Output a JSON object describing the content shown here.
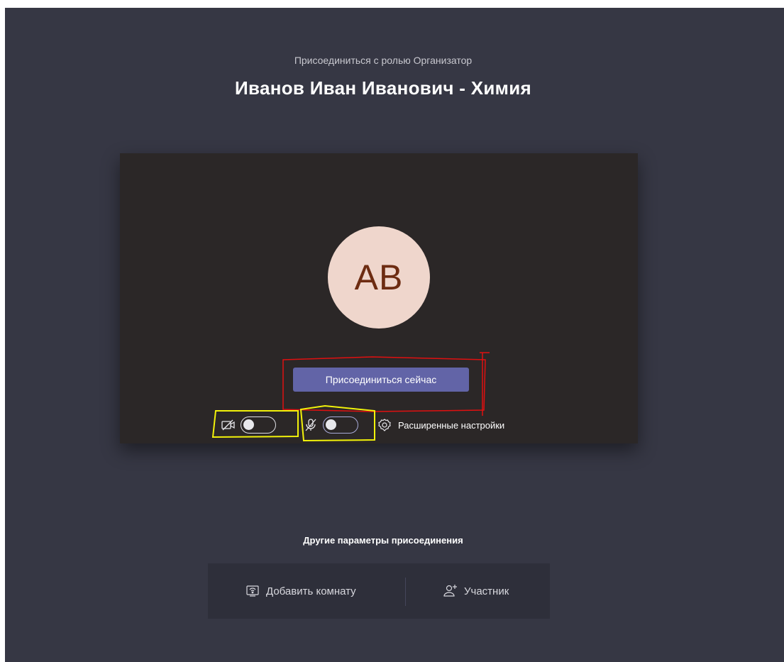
{
  "header": {
    "subtitle": "Присоединиться с ролью Организатор",
    "title": "Иванов Иван Иванович - Химия"
  },
  "preview": {
    "avatar_initials": "AB",
    "join_button": "Присоединиться сейчас",
    "camera": {
      "icon": "camera-off-icon",
      "enabled": false
    },
    "microphone": {
      "icon": "mic-off-icon",
      "enabled": false
    },
    "advanced_settings": {
      "icon": "gear-icon",
      "label": "Расширенные настройки"
    }
  },
  "other_options": {
    "label": "Другие параметры присоединения",
    "add_room": {
      "icon": "room-cast-icon",
      "label": "Добавить комнату"
    },
    "participant": {
      "icon": "add-person-icon",
      "label": "Участник"
    }
  },
  "colors": {
    "background": "#363744",
    "preview_bg": "#2b2727",
    "accent": "#6264a7",
    "avatar_bg": "#efd6cc",
    "avatar_text": "#6d2c12",
    "annotation_red": "#e01010",
    "annotation_yellow": "#f2f20a"
  }
}
